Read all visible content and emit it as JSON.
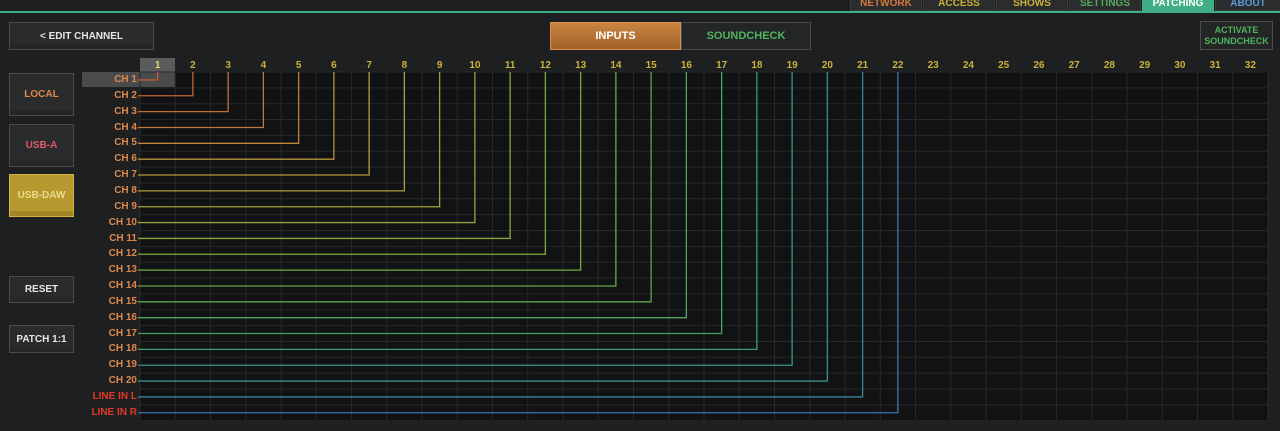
{
  "top_tabs": [
    {
      "label": "NETWORK",
      "key": "network"
    },
    {
      "label": "ACCESS",
      "key": "access"
    },
    {
      "label": "SHOWS",
      "key": "shows"
    },
    {
      "label": "SETTINGS",
      "key": "settings"
    },
    {
      "label": "PATCHING",
      "key": "patching"
    },
    {
      "label": "ABOUT",
      "key": "about"
    }
  ],
  "edit_channel_label": "< EDIT CHANNEL",
  "mode_tabs": {
    "inputs": "INPUTS",
    "soundcheck": "SOUNDCHECK"
  },
  "activate_soundcheck_line1": "ACTIVATE",
  "activate_soundcheck_line2": "SOUNDCHECK",
  "sources": {
    "local": "LOCAL",
    "usba": "USB-A",
    "usbdaw": "USB-DAW"
  },
  "actions": {
    "reset": "RESET",
    "patch11": "PATCH 1:1"
  },
  "columns": [
    "1",
    "2",
    "3",
    "4",
    "5",
    "6",
    "7",
    "8",
    "9",
    "10",
    "11",
    "12",
    "13",
    "14",
    "15",
    "16",
    "17",
    "18",
    "19",
    "20",
    "21",
    "22",
    "23",
    "24",
    "25",
    "26",
    "27",
    "28",
    "29",
    "30",
    "31",
    "32"
  ],
  "rows": [
    "CH 1",
    "CH 2",
    "CH 3",
    "CH 4",
    "CH 5",
    "CH 6",
    "CH 7",
    "CH 8",
    "CH 9",
    "CH 10",
    "CH 11",
    "CH 12",
    "CH 13",
    "CH 14",
    "CH 15",
    "CH 16",
    "CH 17",
    "CH 18",
    "CH 19",
    "CH 20",
    "LINE IN L",
    "LINE IN R"
  ],
  "patches": [
    [
      1,
      1
    ],
    [
      2,
      2
    ],
    [
      3,
      3
    ],
    [
      4,
      4
    ],
    [
      5,
      5
    ],
    [
      6,
      6
    ],
    [
      7,
      7
    ],
    [
      8,
      8
    ],
    [
      9,
      9
    ],
    [
      10,
      10
    ],
    [
      11,
      11
    ],
    [
      12,
      12
    ],
    [
      13,
      13
    ],
    [
      14,
      14
    ],
    [
      15,
      15
    ],
    [
      16,
      16
    ],
    [
      17,
      17
    ],
    [
      18,
      18
    ],
    [
      19,
      19
    ],
    [
      20,
      20
    ],
    [
      21,
      21
    ],
    [
      22,
      22
    ]
  ],
  "colors": {
    "accent": "#3fae84",
    "row_channel": "#e0884a",
    "row_line": "#e03a2a",
    "col_header": "#c9b338"
  }
}
